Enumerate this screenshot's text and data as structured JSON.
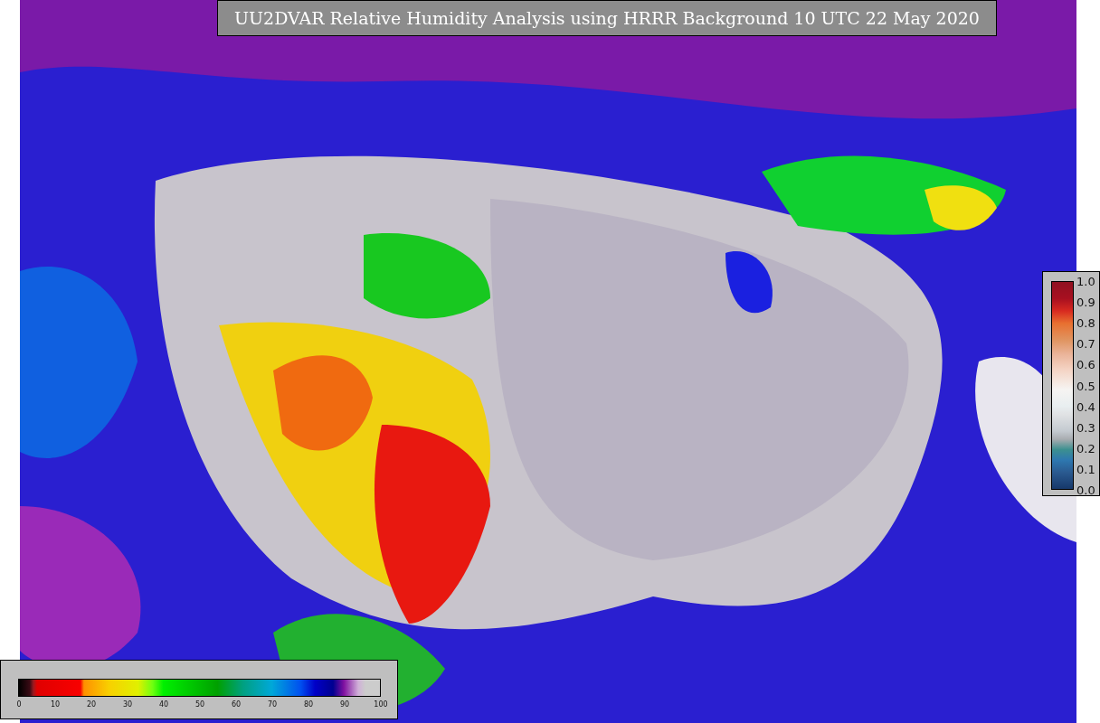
{
  "title": "UU2DVAR Relative Humidity Analysis using HRRR Background 10 UTC 22 May 2020",
  "humidity_legend": {
    "ticks": [
      "0",
      "10",
      "20",
      "30",
      "40",
      "50",
      "60",
      "70",
      "80",
      "90",
      "100"
    ]
  },
  "observation_legend": {
    "ticks": [
      "1.0",
      "0.9",
      "0.8",
      "0.7",
      "0.6",
      "0.5",
      "0.4",
      "0.3",
      "0.2",
      "0.1",
      "0.0"
    ]
  }
}
